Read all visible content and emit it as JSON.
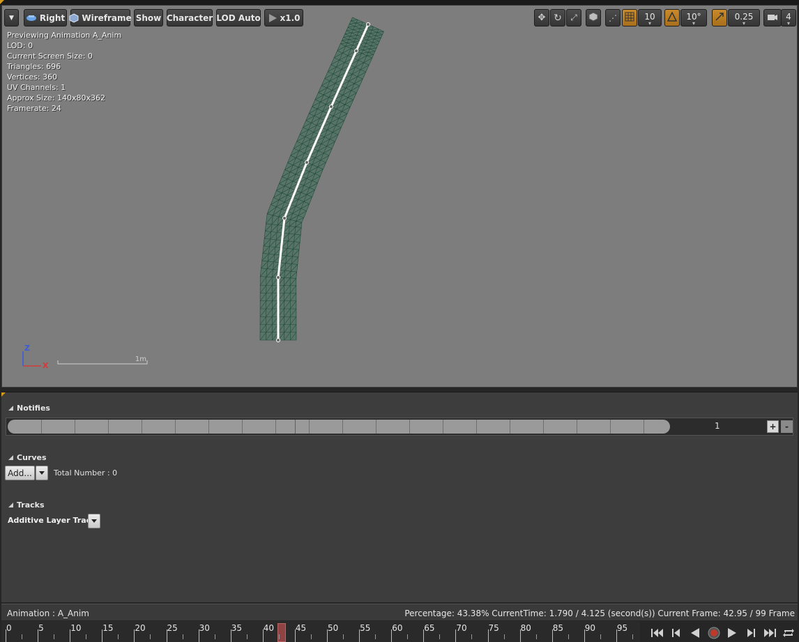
{
  "toolbar": {
    "view_label": "Right",
    "wireframe_label": "Wireframe",
    "show_label": "Show",
    "character_label": "Character",
    "lod_label": "LOD Auto",
    "speed_label": "x1.0",
    "grid_snap_value": "10",
    "angle_snap_value": "10°",
    "scale_snap_value": "0.25",
    "camera_speed_value": "4"
  },
  "stats": {
    "lines": [
      "Previewing Animation A_Anim",
      "LOD: 0",
      "Current Screen Size: 0",
      "Triangles: 696",
      "Vertices: 360",
      "UV Channels: 1",
      "Approx Size: 140x80x362",
      "Framerate: 24"
    ]
  },
  "axis": {
    "z": "Z",
    "x": "X"
  },
  "scale_label": "1m",
  "sections": {
    "notifies": "Notifies",
    "curves": "Curves",
    "tracks": "Tracks"
  },
  "notifies": {
    "track_number": "1",
    "plus": "+",
    "minus": "-"
  },
  "curves": {
    "add_label": "Add...",
    "total": "Total Number : 0"
  },
  "tracks": {
    "additive_label": "Additive Layer Tracks"
  },
  "status": {
    "animation": "Animation :  A_Anim",
    "info": "Percentage:  43.38% CurrentTime:  1.790 / 4.125 (second(s)) Current Frame:  42.95 / 99 Frame"
  },
  "timeline": {
    "labels": [
      "0",
      "5",
      "10",
      "15",
      "20",
      "25",
      "30",
      "35",
      "40",
      "45",
      "50",
      "55",
      "60",
      "65",
      "70",
      "75",
      "80",
      "85",
      "90",
      "95"
    ],
    "current_frame": 42.95,
    "total_frames": 99
  },
  "colors": {
    "accent": "#d49b1c",
    "mesh": "#3a6e58",
    "bone": "#ffffff",
    "scrub": "#a24848",
    "record": "#c0392b"
  }
}
